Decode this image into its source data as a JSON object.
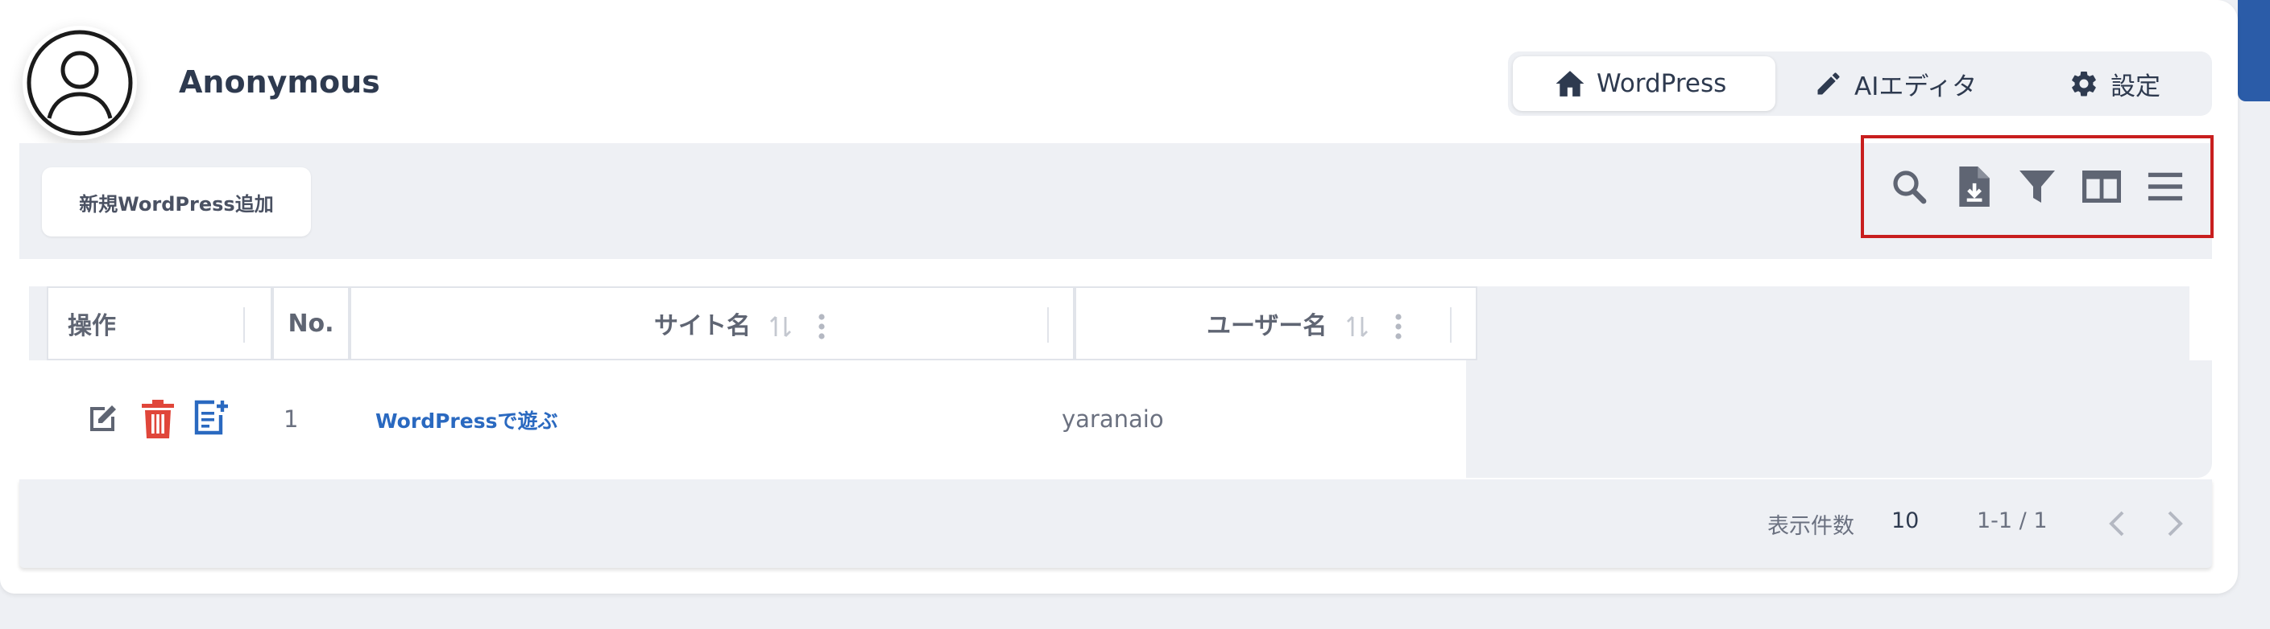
{
  "user": {
    "name": "Anonymous"
  },
  "nav": {
    "items": [
      {
        "label": "WordPress",
        "icon": "home-icon"
      },
      {
        "label": "AIエディタ",
        "icon": "pencil-icon"
      },
      {
        "label": "設定",
        "icon": "gear-icon"
      }
    ],
    "active": "WordPress"
  },
  "toolbar": {
    "add_button": "新規WordPress追加",
    "icons": [
      "search-icon",
      "download-file-icon",
      "filter-icon",
      "columns-icon",
      "menu-icon"
    ],
    "highlight_color": "#c81e1e"
  },
  "table": {
    "columns": [
      "操作",
      "No.",
      "サイト名",
      "ユーザー名"
    ],
    "rows": [
      {
        "no": "1",
        "site_name": "WordPressで遊ぶ",
        "user_name": "yaranaio"
      }
    ],
    "row_action_icons": [
      "edit-icon",
      "trash-icon",
      "add-note-icon"
    ]
  },
  "pagination": {
    "per_page_label": "表示件数",
    "per_page_value": "10",
    "range": "1-1 / 1"
  },
  "colors": {
    "accent": "#2b5ca8",
    "link": "#2a69c0",
    "danger": "#e0463a"
  }
}
